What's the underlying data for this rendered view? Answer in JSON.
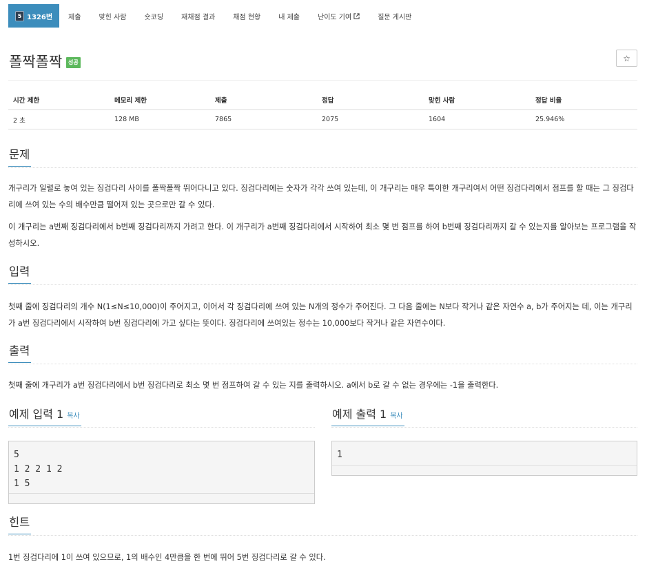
{
  "nav": {
    "tabs": [
      {
        "label": "1326번",
        "tier_icon": "5"
      },
      {
        "label": "제출"
      },
      {
        "label": "맞힌 사람"
      },
      {
        "label": "숏코딩"
      },
      {
        "label": "재채점 결과"
      },
      {
        "label": "채점 현황"
      },
      {
        "label": "내 제출"
      },
      {
        "label": "난이도 기여"
      },
      {
        "label": "질문 게시판"
      }
    ]
  },
  "problem": {
    "title": "폴짝폴짝",
    "status_badge": "성공",
    "star_icon": "☆"
  },
  "info_table": {
    "headers": [
      "시간 제한",
      "메모리 제한",
      "제출",
      "정답",
      "맞힌 사람",
      "정답 비율"
    ],
    "row": [
      "2 초",
      "128 MB",
      "7865",
      "2075",
      "1604",
      "25.946%"
    ]
  },
  "sections": {
    "description": {
      "heading": "문제",
      "paragraphs": [
        "개구리가 일렬로 놓여 있는 징검다리 사이를 폴짝폴짝 뛰어다니고 있다. 징검다리에는 숫자가 각각 쓰여 있는데, 이 개구리는 매우 특이한 개구리여서 어떤 징검다리에서 점프를 할 때는 그 징검다리에 쓰여 있는 수의 배수만큼 떨어져 있는 곳으로만 갈 수 있다.",
        "이 개구리는 a번째 징검다리에서 b번째 징검다리까지 가려고 한다. 이 개구리가 a번째 징검다리에서 시작하여 최소 몇 번 점프를 하여 b번째 징검다리까지 갈 수 있는지를 알아보는 프로그램을 작성하시오."
      ]
    },
    "input": {
      "heading": "입력",
      "text": "첫째 줄에 징검다리의 개수 N(1≤N≤10,000)이 주어지고, 이어서 각 징검다리에 쓰여 있는 N개의 정수가 주어진다. 그 다음 줄에는 N보다 작거나 같은 자연수 a, b가 주어지는 데, 이는 개구리가 a번 징검다리에서 시작하여 b번 징검다리에 가고 싶다는 뜻이다. 징검다리에 쓰여있는 정수는 10,000보다 작거나 같은 자연수이다."
    },
    "output": {
      "heading": "출력",
      "text": "첫째 줄에 개구리가 a번 징검다리에서 b번 징검다리로 최소 몇 번 점프하여 갈 수 있는 지를 출력하시오. a에서 b로 갈 수 없는 경우에는 -1을 출력한다."
    },
    "sample_input": {
      "heading": "예제 입력 1",
      "copy_label": "복사",
      "content": "5\n1 2 2 1 2\n1 5"
    },
    "sample_output": {
      "heading": "예제 출력 1",
      "copy_label": "복사",
      "content": "1"
    },
    "hint": {
      "heading": "힌트",
      "text": "1번 징검다리에 1이 쓰여 있으므로, 1의 배수인 4만큼을 한 번에 뛰어 5번 징검다리로 갈 수 있다."
    }
  },
  "colors": {
    "accent": "#3c8dbc",
    "success": "#5cb85c",
    "sample_bg": "#f5f5f5"
  }
}
